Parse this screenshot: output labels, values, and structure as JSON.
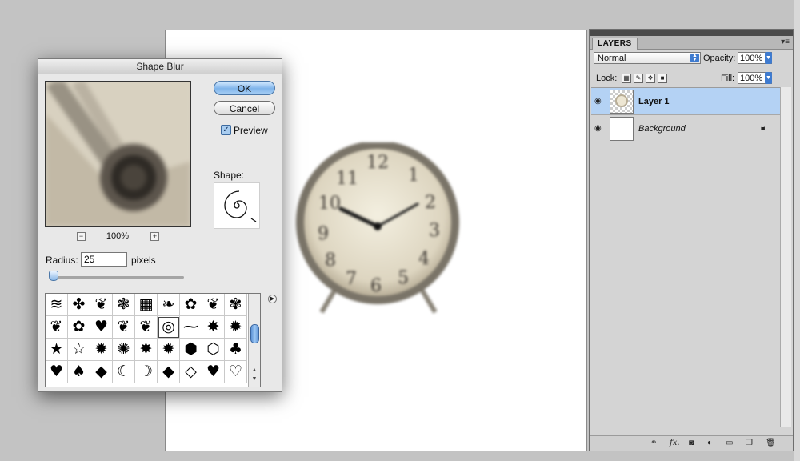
{
  "dialog": {
    "title": "Shape Blur",
    "ok_label": "OK",
    "cancel_label": "Cancel",
    "preview_checked": true,
    "preview_label": "Preview",
    "zoom": "100%",
    "zoom_out": "−",
    "zoom_in": "+",
    "shape_label": "Shape:",
    "radius_label": "Radius:",
    "radius_value": "25",
    "radius_unit": "pixels",
    "radius_slider_fraction": 0.05,
    "shape_glyphs": [
      "≋",
      "✤",
      "❦",
      "❃",
      "▦",
      "❧",
      "✿",
      "❦",
      "✾",
      "❦",
      "✿",
      "♥",
      "❦",
      "❦",
      "◎",
      "⁓",
      "✸",
      "✹",
      "★",
      "☆",
      "✹",
      "✺",
      "✸",
      "✹",
      "⬢",
      "⬡",
      "♣",
      "♥",
      "♠",
      "◆",
      "☾",
      "☽",
      "◆",
      "◇",
      "♥",
      "♡"
    ],
    "selected_shape_index": 14
  },
  "layers_panel": {
    "tab": "LAYERS",
    "blend_mode": "Normal",
    "opacity_label": "Opacity:",
    "opacity_value": "100%",
    "lock_label": "Lock:",
    "fill_label": "Fill:",
    "fill_value": "100%",
    "layers": [
      {
        "name": "Layer 1",
        "visible": true,
        "active": true
      },
      {
        "name": "Background",
        "visible": true,
        "active": false,
        "locked": true
      }
    ]
  },
  "colors": {
    "ok_button": "#7fb4ea",
    "active_layer": "#b4d2f4",
    "app_background": "#c3c3c3"
  }
}
